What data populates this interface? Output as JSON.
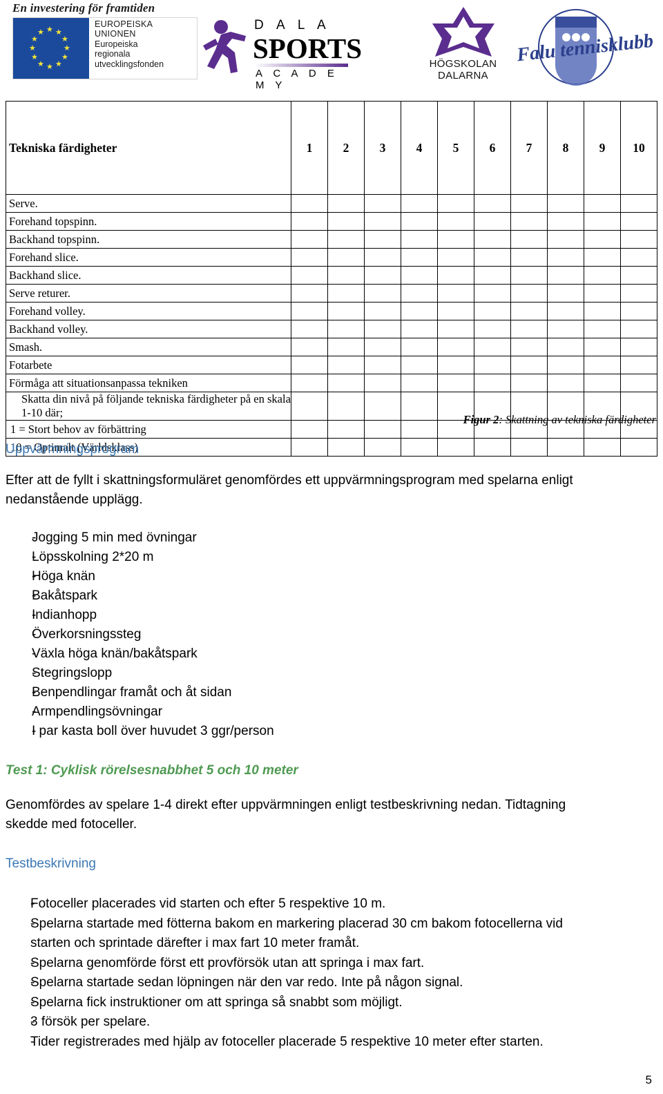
{
  "header": {
    "eu": {
      "tagline": "En investering för framtiden",
      "lines": [
        "EUROPEISKA",
        "UNIONEN",
        "Europeiska",
        "regionala",
        "utvecklingsfonden"
      ]
    },
    "dala_sports": {
      "word_dala": "D A L A",
      "word_sports": "SPORTS",
      "word_academy": "A C A D E M Y"
    },
    "hogskolan": {
      "line1": "HÖGSKOLAN",
      "line2": "DALARNA"
    },
    "falu": {
      "name": "Falu tennisklubb"
    }
  },
  "table": {
    "title": "Tekniska färdigheter",
    "columns": [
      "1",
      "2",
      "3",
      "4",
      "5",
      "6",
      "7",
      "8",
      "9",
      "10"
    ],
    "rows": [
      "Serve.",
      "Forehand topspinn.",
      "Backhand  topspinn.",
      "Forehand slice.",
      "Backhand slice.",
      "Serve returer.",
      "Forehand volley.",
      "Backhand volley.",
      "Smash.",
      "Fotarbete",
      "Förmåga att situationsanpassa tekniken"
    ],
    "notes": [
      "Skatta din nivå på följande tekniska färdigheter på en skala 1-10 där;",
      "1 = Stort behov av förbättring",
      "10 = Optimalt (Världsklass)"
    ]
  },
  "figure_caption": {
    "label": "Figur 2",
    "text": ": Skattning av tekniska färdigheter"
  },
  "warmup": {
    "heading": "Uppvärmningsprogram",
    "intro_line1": "Efter att de fyllt i skattningsformuläret genomfördes ett uppvärmningsprogram med spelarna enligt",
    "intro_line2": "nedanstående upplägg.",
    "dash": "-",
    "items": [
      "Jogging 5 min med övningar",
      "Löpsskolning 2*20 m",
      "Höga knän",
      "Bakåtspark",
      "Indianhopp",
      "Överkorsningssteg",
      "Växla höga knän/bakåtspark",
      "Stegringslopp",
      "Benpendlingar framåt och åt sidan",
      "Armpendlingsövningar",
      "I par kasta boll över huvudet 3 ggr/person"
    ]
  },
  "test1": {
    "heading": "Test 1: Cyklisk rörelsesnabbhet 5 och 10 meter",
    "intro_line1": "Genomfördes av spelare 1-4 direkt efter uppvärmningen enligt testbeskrivning nedan. Tidtagning",
    "intro_line2": "skedde med fotoceller.",
    "subheading": "Testbeskrivning",
    "dash": "-",
    "items": [
      [
        "Fotoceller placerades vid starten och efter 5 respektive 10 m."
      ],
      [
        "Spelarna startade med fötterna bakom en markering placerad 30 cm bakom fotocellerna vid",
        "starten och sprintade därefter i max fart 10 meter framåt."
      ],
      [
        "Spelarna genomförde först ett provförsök utan att springa i max fart."
      ],
      [
        "Spelarna startade sedan löpningen när den var redo. Inte på någon signal."
      ],
      [
        "Spelarna fick instruktioner om att springa så snabbt som möjligt."
      ],
      [
        "3 försök per spelare."
      ],
      [
        "Tider registrerades med hjälp av fotoceller placerade 5 respektive 10 meter efter starten."
      ]
    ]
  },
  "page_number": "5",
  "colors": {
    "blue_heading": "#3c78b4",
    "green_heading": "#4f9a52",
    "eu_flag": "#1b4a9c",
    "purple": "#5b2d8e",
    "falu_blue": "#2b3f8c"
  }
}
